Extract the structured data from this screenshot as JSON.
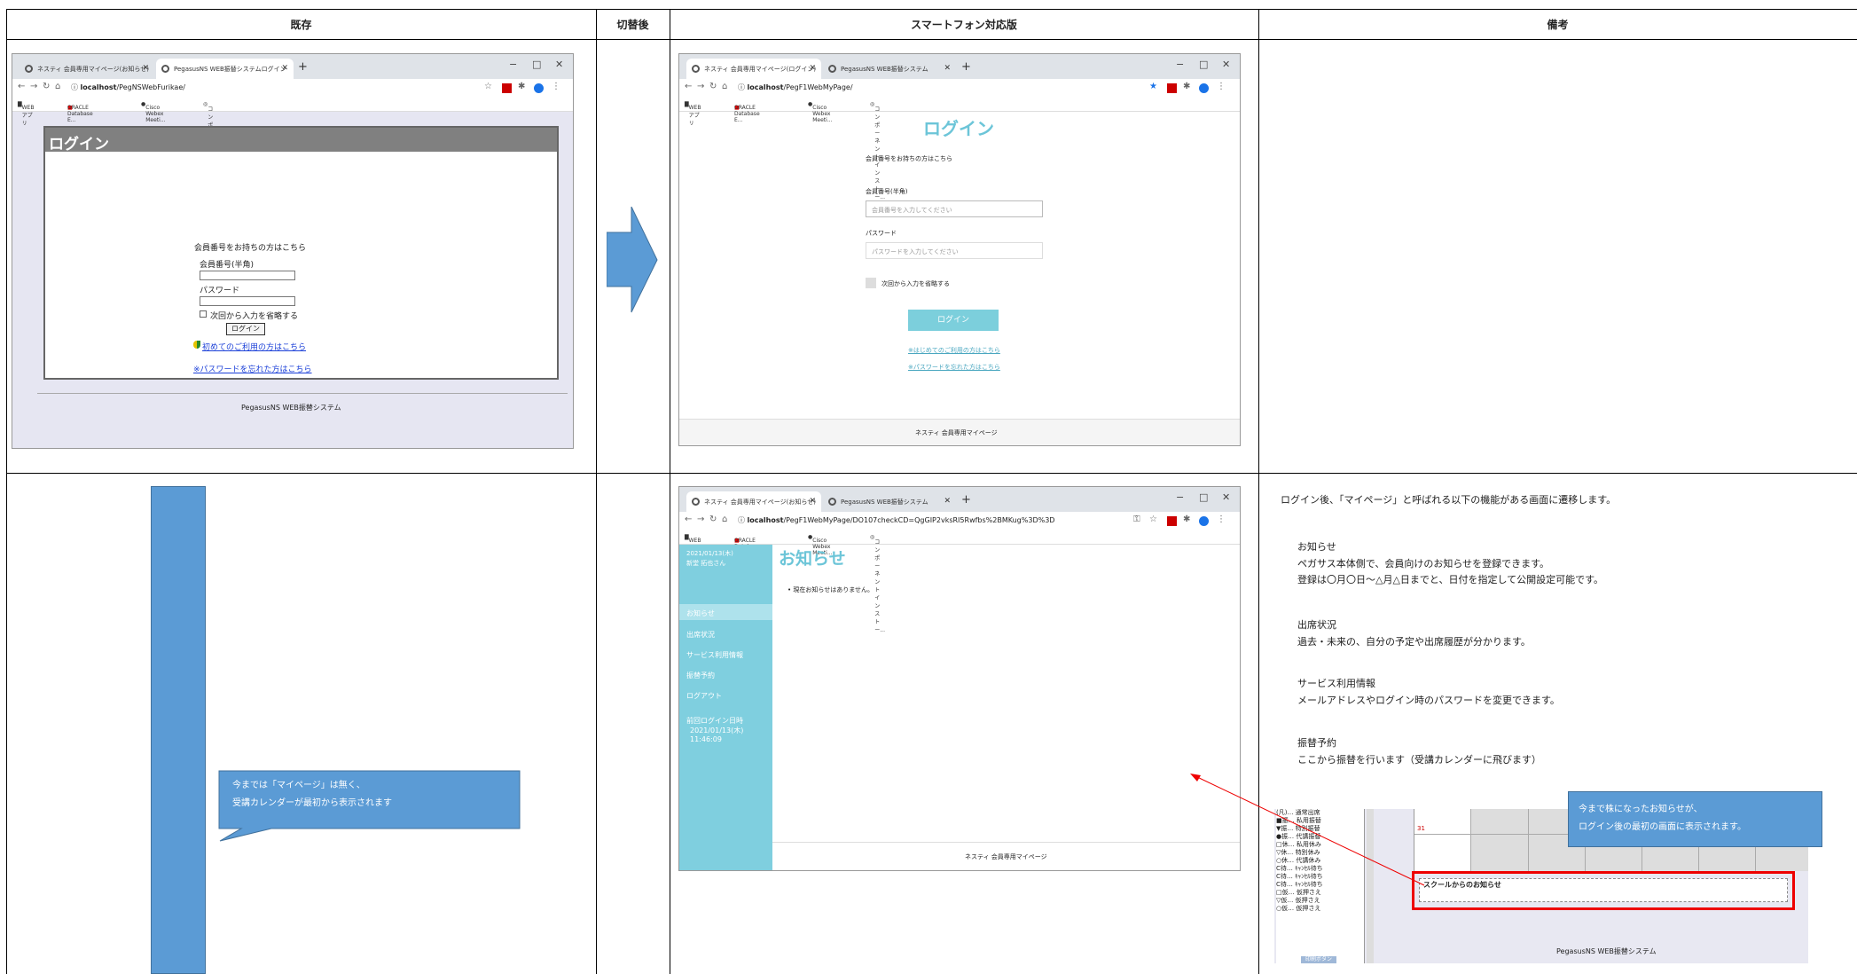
{
  "headers": {
    "col1": "既存",
    "col2": "切替後",
    "col3": "スマートフォン対応版",
    "col4": "備考"
  },
  "browser": {
    "tab1_old": "ネスティ 会員専用マイページ(お知らせ)",
    "tab2_old": "PegasusNS WEB振替システムログイン",
    "tab1_new": "ネスティ 会員専用マイページ(ログイン)",
    "tab2_new": "PegasusNS WEB振替システム",
    "tab1_mp": "ネスティ 会員専用マイページ(お知らせ)",
    "tab2_mp": "PegasusNS WEB振替システム",
    "url_host": "localhost",
    "url_old_path": "/PegNSWebFurikae/",
    "url_new_path": "/PegF1WebMyPage/",
    "url_mp_path": "/PegF1WebMyPage/DO107checkCD=QgGIP2vksRI5Rwfbs%2BMKug%3D%3D",
    "bookmarks": [
      "WEBアプリ",
      "ORACLE Database E...",
      "Cisco Webex Meeti...",
      "コンポーネントインストー..."
    ],
    "plus": "+",
    "min": "−",
    "max": "□",
    "close": "✕",
    "tabx": "✕"
  },
  "old_login": {
    "title": "ログイン",
    "intro": "会員番号をお持ちの方はこちら",
    "member_label": "会員番号(半角)",
    "password_label": "パスワード",
    "remember": "次回から入力を省略する",
    "button": "ログイン",
    "first_link": "初めてのご利用の方はこちら",
    "forgot_link": "※パスワードを忘れた方はこちら",
    "footer": "PegasusNS WEB振替システム"
  },
  "new_login": {
    "title": "ログイン",
    "intro": "会員番号をお持ちの方はこちら",
    "member_label": "会員番号(半角)",
    "member_placeholder": "会員番号を入力してください",
    "password_label": "パスワード",
    "password_placeholder": "パスワードを入力してください",
    "remember": "次回から入力を省略する",
    "button": "ログイン",
    "first_link": "※はじめてのご利用の方はこちら",
    "forgot_link": "※パスワードを忘れた方はこちら",
    "footer": "ネスティ 会員専用マイページ"
  },
  "mypage": {
    "date": "2021/01/13(木)",
    "user": "新堂 拓也さん",
    "title": "お知らせ",
    "bullet": "現在お知らせはありません。",
    "menu": [
      "お知らせ",
      "出席状況",
      "サービス利用情報",
      "振替予約",
      "ログアウト"
    ],
    "last_login_label": "前回ログイン日時",
    "last_login_date": "2021/01/13(木)",
    "last_login_time": "11:46:09",
    "footer": "ネスティ 会員専用マイページ"
  },
  "callout_left": {
    "line1": "今までは「マイページ」は無く、",
    "line2": "受講カレンダーが最初から表示されます"
  },
  "remarks": {
    "intro": "ログイン後、「マイページ」と呼ばれる以下の機能がある画面に遷移します。",
    "items": [
      {
        "title": "お知らせ",
        "lines": [
          "ペガサス本体側で、会員向けのお知らせを登録できます。",
          "登録は〇月〇日〜△月△日までと、日付を指定して公開設定可能です。"
        ]
      },
      {
        "title": "出席状況",
        "lines": [
          "過去・未来の、自分の予定や出席履歴が分かります。"
        ]
      },
      {
        "title": "サービス利用情報",
        "lines": [
          "メールアドレスやログイン時のパスワードを変更できます。"
        ]
      },
      {
        "title": "振替予約",
        "lines": [
          "ここから振替を行います（受講カレンダーに飛びます）"
        ]
      }
    ]
  },
  "callout_right": {
    "line1": "今まで株になったお知らせが、",
    "line2": "ログイン後の最初の画面に表示されます。"
  },
  "calendar": {
    "day": "31",
    "notice_box": "スクールからのお知らせ",
    "footer": "PegasusNS WEB振替システム",
    "legend": [
      "(凡)… 通常出席",
      "■振… 私用振替",
      "▼振… 特別振替",
      "●振… 代講振替",
      "□休… 私用休み",
      "▽休… 特別休み",
      "○休… 代講休み",
      "C待… ｷｬﾝｾﾙ待ち",
      "C待… ｷｬﾝｾﾙ待ち",
      "C待… ｷｬﾝｾﾙ待ち",
      "□仮… 仮押さえ",
      "▽仮… 仮押さえ",
      "○仮… 仮押さえ"
    ],
    "bottom_button": "印刷ボタン"
  }
}
